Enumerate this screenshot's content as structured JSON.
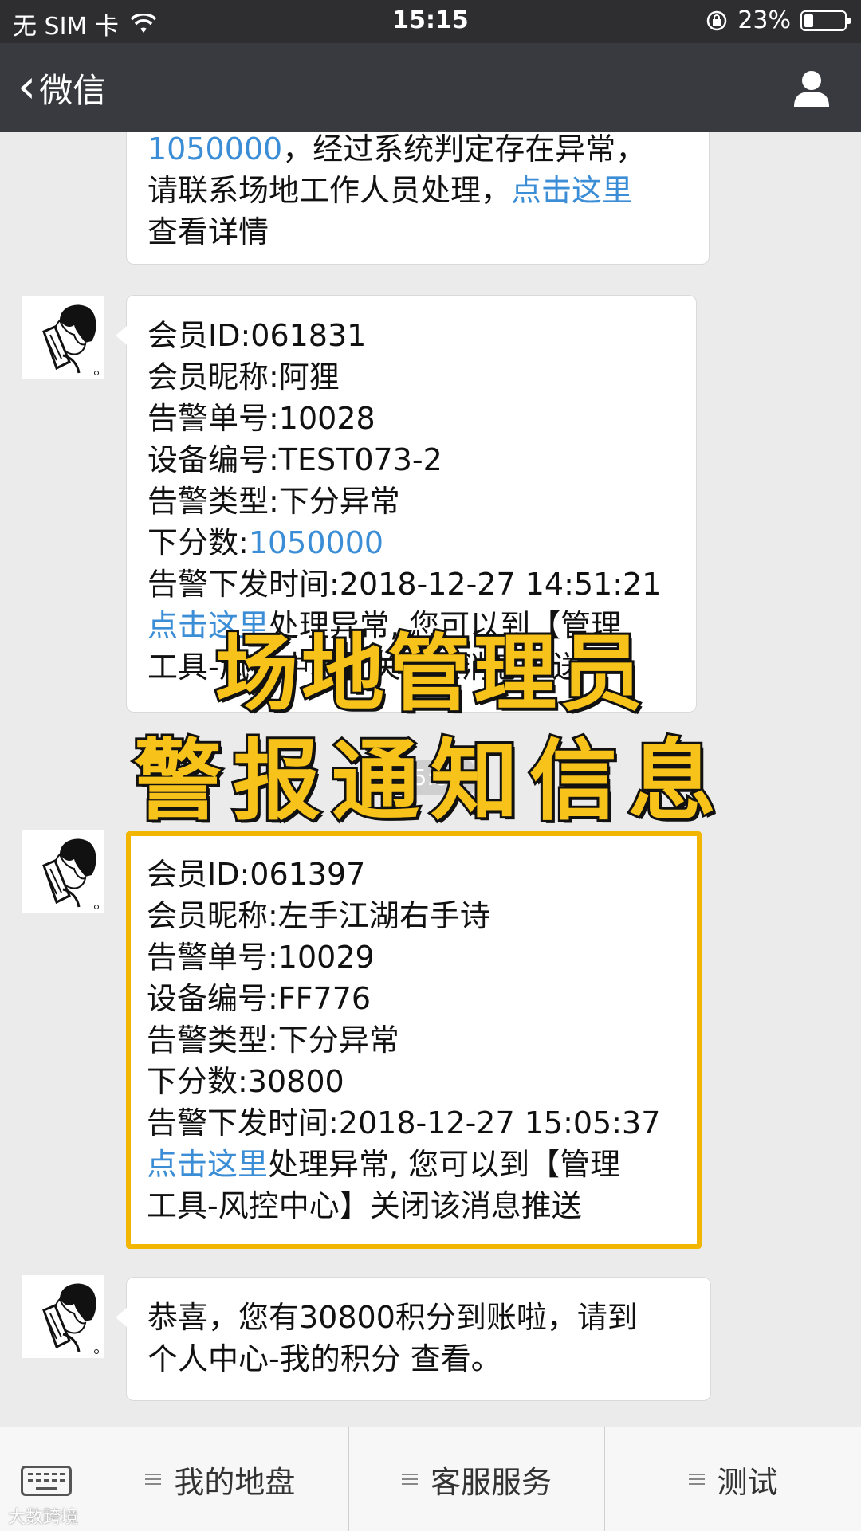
{
  "status_bar": {
    "carrier": "无 SIM 卡",
    "time": "15:15",
    "battery_percent": "23%",
    "battery_level": 0.23
  },
  "nav": {
    "back_label": "微信"
  },
  "messages": {
    "m1": {
      "line1_num": "1050000",
      "line1_rest": "，经过系统判定存在异常，",
      "line2_pre": "请联系场地工作人员处理，",
      "line2_link": "点击这里",
      "line3": "查看详情"
    },
    "m2": {
      "l1": "会员ID:061831",
      "l2": "会员昵称:阿狸",
      "l3": "告警单号:10028",
      "l4": "设备编号:TEST073-2",
      "l5": "告警类型:下分异常",
      "l6_pre": "下分数:",
      "l6_num": "1050000",
      "l7": "告警下发时间:2018-12-27 14:51:21",
      "l8_link": "点击这里",
      "l8_rest": "处理异常, 您可以到【管理",
      "l9": "工具-风控中心】关闭该消息推送"
    },
    "timestamp": "15:05",
    "m3": {
      "l1": "会员ID:061397",
      "l2": "会员昵称:左手江湖右手诗",
      "l3": "告警单号:10029",
      "l4": "设备编号:FF776",
      "l5": "告警类型:下分异常",
      "l6": "下分数:30800",
      "l7": "告警下发时间:2018-12-27 15:05:37",
      "l8_link": "点击这里",
      "l8_rest": "处理异常, 您可以到【管理",
      "l9": "工具-风控中心】关闭该消息推送"
    },
    "m4": {
      "l1": "恭喜，您有30800积分到账啦，请到",
      "l2": " 个人中心-我的积分 查看。"
    }
  },
  "caption": {
    "line1": "场地管理员",
    "line2": "警报通知信息"
  },
  "bottom_menu": {
    "items": [
      "我的地盘",
      "客服服务",
      "测试"
    ]
  },
  "watermark": "大数跨境",
  "colors": {
    "accent_link": "#3b8ed6",
    "highlight_border": "#f2b500",
    "caption_fill": "#f7c21a",
    "navbar": "#393a3f"
  }
}
